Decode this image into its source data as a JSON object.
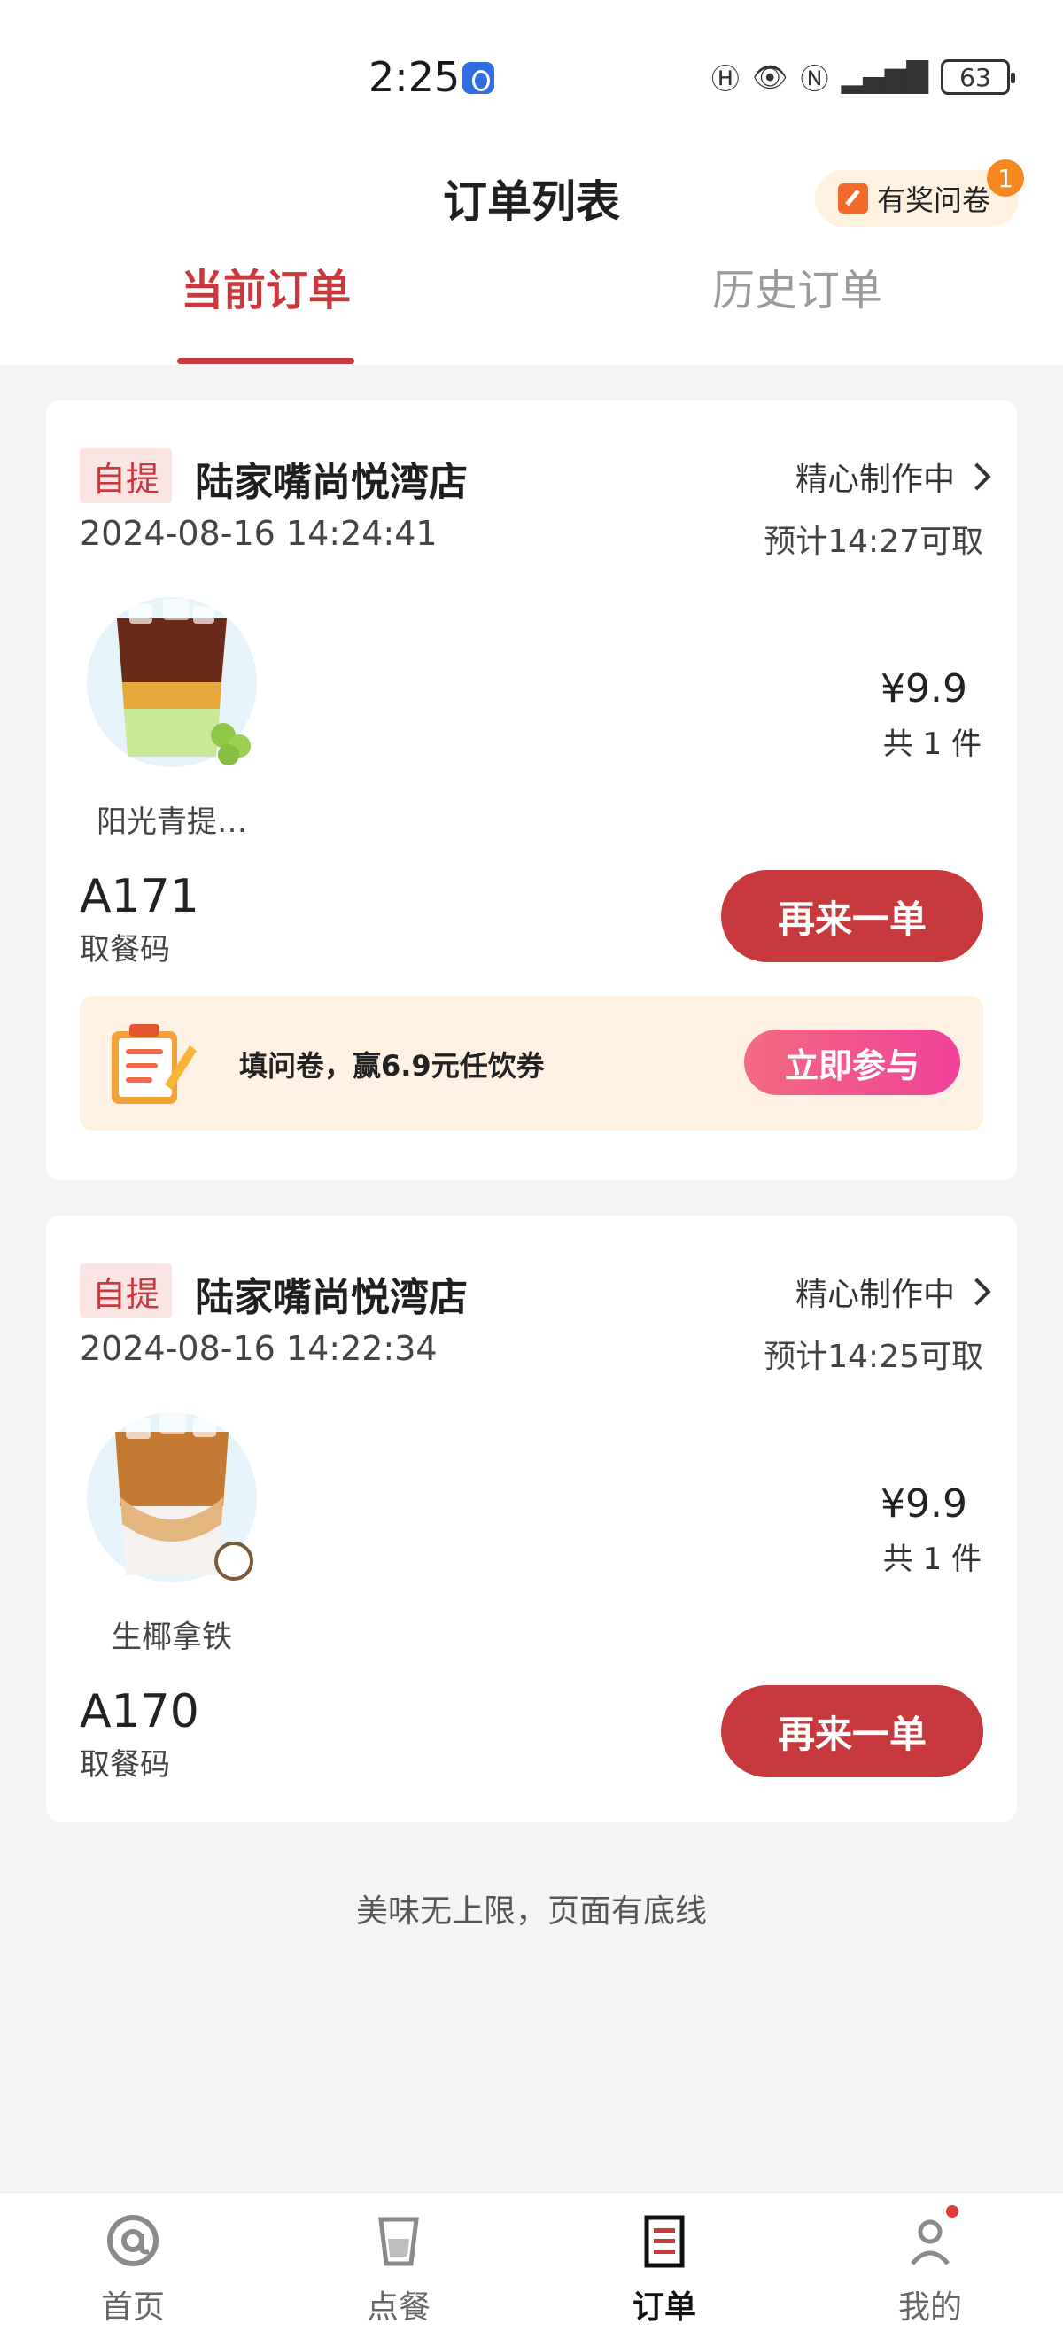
{
  "status_bar": {
    "time": "2:25",
    "battery": "63",
    "icons": [
      "hd-icon",
      "eye-icon",
      "nfc-icon",
      "5g-signal-icon",
      "battery-icon"
    ]
  },
  "header": {
    "title": "订单列表",
    "survey_label": "有奖问卷",
    "survey_badge": "1",
    "tabs": [
      {
        "label": "当前订单",
        "active": true
      },
      {
        "label": "历史订单",
        "active": false
      }
    ]
  },
  "orders": [
    {
      "tag": "自提",
      "store": "陆家嘴尚悦湾店",
      "status": "精心制作中",
      "time": "2024-08-16 14:24:41",
      "eta": "预计14:27可取",
      "product_name": "阳光青提…",
      "price": "¥9.9",
      "qty": "共 1 件",
      "pickup_code": "A171",
      "pickup_label": "取餐码",
      "reorder_label": "再来一单",
      "promo_text": "填问卷，赢6.9元任饮券",
      "promo_button": "立即参与"
    },
    {
      "tag": "自提",
      "store": "陆家嘴尚悦湾店",
      "status": "精心制作中",
      "time": "2024-08-16 14:22:34",
      "eta": "预计14:25可取",
      "product_name": "生椰拿铁",
      "price": "¥9.9",
      "qty": "共 1 件",
      "pickup_code": "A170",
      "pickup_label": "取餐码",
      "reorder_label": "再来一单"
    }
  ],
  "footer_note": "美味无上限，页面有底线",
  "bottom_nav": [
    {
      "label": "首页",
      "icon": "home-at-icon",
      "active": false
    },
    {
      "label": "点餐",
      "icon": "cup-icon",
      "active": false
    },
    {
      "label": "订单",
      "icon": "order-list-icon",
      "active": true
    },
    {
      "label": "我的",
      "icon": "person-icon",
      "active": false
    }
  ],
  "colors": {
    "accent": "#c8393d",
    "promo_bg": "#fff1e4",
    "page_bg": "#f4f4f4"
  }
}
